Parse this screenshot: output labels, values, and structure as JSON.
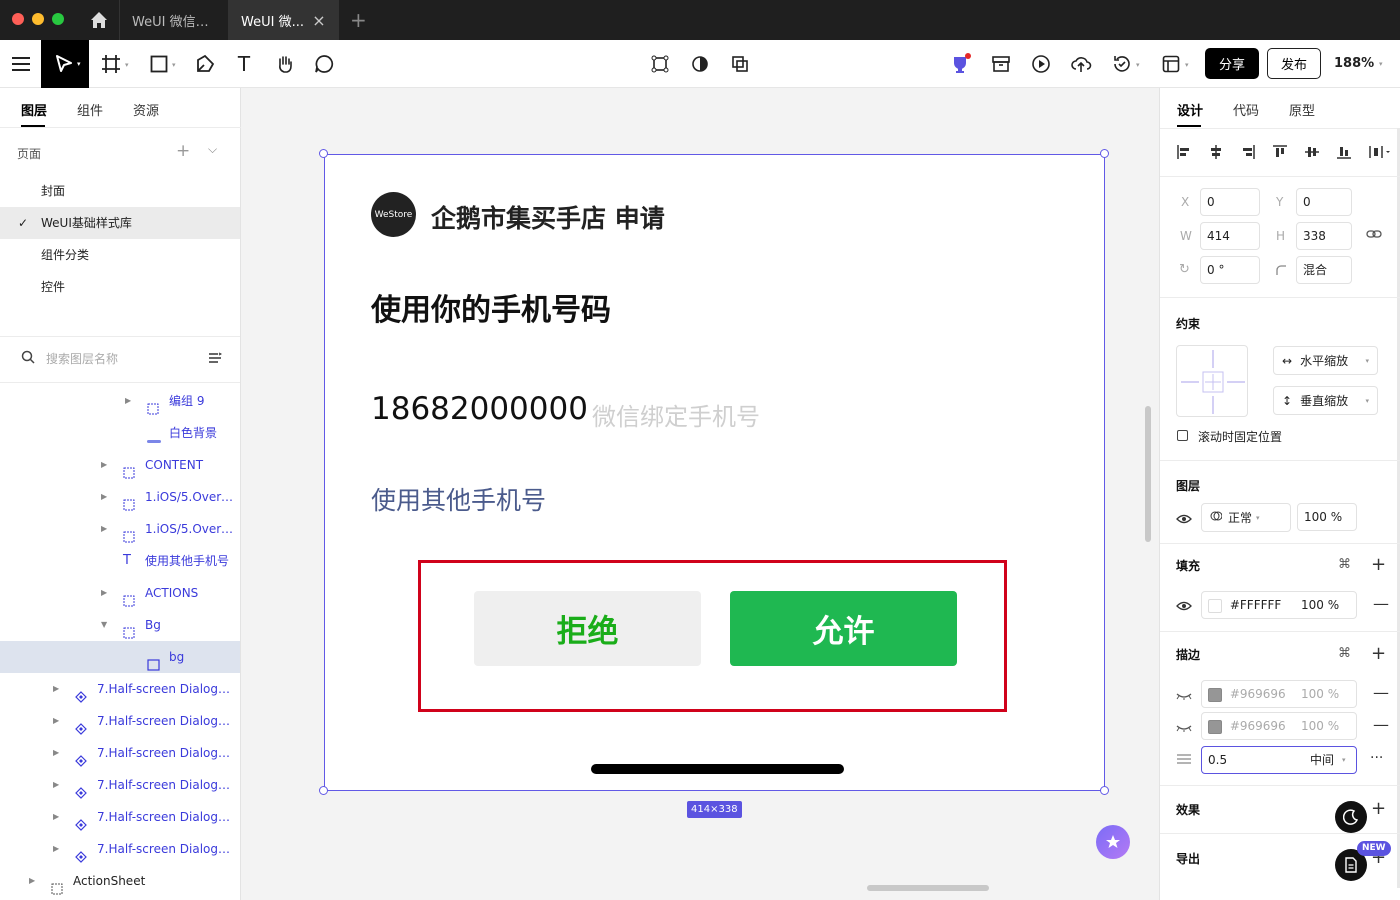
{
  "window": {
    "tabs": [
      {
        "label": "WeUI 微信小..."
      },
      {
        "label": "WeUI 微..."
      }
    ]
  },
  "toolbar": {
    "share_label": "分享",
    "publish_label": "发布",
    "zoom": "188%"
  },
  "left_panel": {
    "tabs": [
      "图层",
      "组件",
      "资源"
    ],
    "pages_header": "页面",
    "pages": [
      {
        "label": "封面"
      },
      {
        "label": "WeUI基础样式库"
      },
      {
        "label": "组件分类"
      },
      {
        "label": "控件"
      }
    ],
    "search_placeholder": "搜索图层名称",
    "layers": [
      {
        "label": "编组 9"
      },
      {
        "label": "白色背景"
      },
      {
        "label": "CONTENT"
      },
      {
        "label": "1.iOS/5.Overri..."
      },
      {
        "label": "1.iOS/5.Overri..."
      },
      {
        "label": "使用其他手机号"
      },
      {
        "label": "ACTIONS"
      },
      {
        "label": "Bg"
      },
      {
        "label": "bg"
      },
      {
        "label": "7.Half-screen Dialog/..."
      },
      {
        "label": "7.Half-screen Dialog/..."
      },
      {
        "label": "7.Half-screen Dialog/..."
      },
      {
        "label": "7.Half-screen Dialog/L..."
      },
      {
        "label": "7.Half-screen Dialog/..."
      },
      {
        "label": "7.Half-screen Dialog/..."
      },
      {
        "label": "ActionSheet"
      }
    ]
  },
  "canvas": {
    "logo_text": "WeStore",
    "app_title": "企鹅市集买手店 申请",
    "heading": "使用你的手机号码",
    "phone_number": "18682000000",
    "phone_hint": "微信绑定手机号",
    "other_phone": "使用其他手机号",
    "reject_label": "拒绝",
    "allow_label": "允许",
    "size_badge": "414×338"
  },
  "right_panel": {
    "tabs": [
      "设计",
      "代码",
      "原型"
    ],
    "x_label": "X",
    "x_value": "0",
    "y_label": "Y",
    "y_value": "0",
    "w_label": "W",
    "w_value": "414",
    "h_label": "H",
    "h_value": "338",
    "rotation_value": "0 °",
    "radius_value": "混合",
    "constraints_title": "约束",
    "horizontal_constraint": "水平缩放",
    "vertical_constraint": "垂直缩放",
    "fix_scroll_label": "滚动时固定位置",
    "layer_title": "图层",
    "blend_mode": "正常",
    "layer_opacity": "100 %",
    "fill_title": "填充",
    "fill_hex": "#FFFFFF",
    "fill_opacity": "100 %",
    "stroke_title": "描边",
    "strokes": [
      {
        "hex": "#969696",
        "opacity": "100 %"
      },
      {
        "hex": "#969696",
        "opacity": "100 %"
      }
    ],
    "stroke_width": "0.5",
    "stroke_position": "中间",
    "effects_title": "效果",
    "export_title": "导出",
    "new_badge": "NEW"
  },
  "colors": {
    "accent": "#6159e6",
    "wechat_green": "#1fb851",
    "highlight_red": "#d0021b",
    "stroke_gray": "#969696"
  }
}
